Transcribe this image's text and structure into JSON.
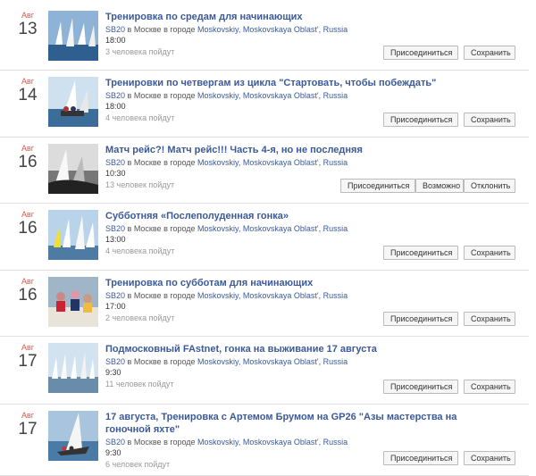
{
  "events": [
    {
      "month": "Авг",
      "day": "13",
      "title": "Тренировка по средам для начинающих",
      "location": {
        "venue": "SB20",
        "prep1": "в Москве",
        "prep2": "в городе",
        "place": "Moskovskiy, Moskovskaya Oblast', Russia"
      },
      "time": "18:00",
      "going": "3 человека пойдут",
      "buttons": [
        "Присоединиться",
        "Сохранить"
      ],
      "thumb": "sailboats-blue-water"
    },
    {
      "month": "Авг",
      "day": "14",
      "title": "Тренировки по четвергам из цикла \"Стартовать, чтобы побеждать\"",
      "location": {
        "venue": "SB20",
        "prep1": "в Москве",
        "prep2": "в городе",
        "place": "Moskovskiy, Moskovskaya Oblast', Russia"
      },
      "time": "18:00",
      "going": "4 человека пойдут",
      "buttons": [
        "Присоединиться",
        "Сохранить"
      ],
      "thumb": "sailboat-crew"
    },
    {
      "month": "Авг",
      "day": "16",
      "title": "Матч рейс?! Матч рейс!!! Часть 4-я, но не последняя",
      "location": {
        "venue": "SB20",
        "prep1": "в Москве",
        "prep2": "в городе",
        "place": "Moskovskiy, Moskovskaya Oblast', Russia"
      },
      "time": "10:30",
      "going": "13 человек пойдут",
      "buttons": [
        "Присоединиться",
        "Возможно",
        "Отклонить"
      ],
      "thumb": "sailboats-grayscale"
    },
    {
      "month": "Авг",
      "day": "16",
      "title": "Субботняя «Послеполуденная гонка»",
      "location": {
        "venue": "SB20",
        "prep1": "в Москве",
        "prep2": "в городе",
        "place": "Moskovskiy, Moskovskaya Oblast', Russia"
      },
      "time": "13:00",
      "going": "4 человека пойдут",
      "buttons": [
        "Присоединиться",
        "Сохранить"
      ],
      "thumb": "sailboats-yellow"
    },
    {
      "month": "Авг",
      "day": "16",
      "title": "Тренировка по субботам для начинающих",
      "location": {
        "venue": "SB20",
        "prep1": "в Москве",
        "prep2": "в городе",
        "place": "Moskovskiy, Moskovskaya Oblast', Russia"
      },
      "time": "17:00",
      "going": "2 человека пойдут",
      "buttons": [
        "Присоединиться",
        "Сохранить"
      ],
      "thumb": "crew-on-deck"
    },
    {
      "month": "Авг",
      "day": "17",
      "title": "Подмосковный FAstnet, гонка на выживание 17 августа",
      "location": {
        "venue": "SB20",
        "prep1": "в Москве",
        "prep2": "в городе",
        "place": "Moskovskiy, Moskovskaya Oblast', Russia"
      },
      "time": "9:30",
      "going": "11 человек пойдут",
      "buttons": [
        "Присоединиться",
        "Сохранить"
      ],
      "thumb": "sailboats-fleet"
    },
    {
      "month": "Авг",
      "day": "17",
      "title": "17 августа, Тренировка с Артемом Брумом на GP26 \"Азы мастерства на гоночной яхте\"",
      "location": {
        "venue": "SB20",
        "prep1": "в Москве",
        "prep2": "в городе",
        "place": "Moskovskiy, Moskovskaya Oblast', Russia"
      },
      "time": "9:30",
      "going": "6 человек пойдут",
      "buttons": [
        "Присоединиться",
        "Сохранить"
      ],
      "thumb": "sailboat-heeling"
    }
  ]
}
